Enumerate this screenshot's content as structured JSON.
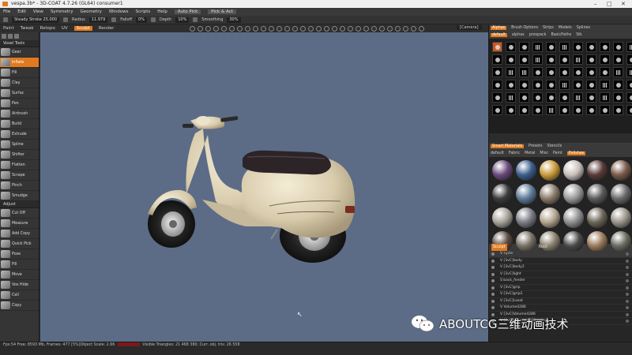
{
  "window": {
    "title": "vespa.3b* - 3D-COAT 4.7.26 (GL64) consumer1"
  },
  "menu": {
    "items": [
      "File",
      "Edit",
      "View",
      "Symmetry",
      "Geometry",
      "Windows",
      "Scripts",
      "Help"
    ],
    "selected": "Auto Pick",
    "pick_act": "Pick & Act"
  },
  "options": {
    "stroke": "Steady Stroke 25.000",
    "radius_label": "Radius",
    "radius": "11.979",
    "falloff_label": "Falloff",
    "falloff": "0%",
    "depth_label": "Depth",
    "depth": "10%",
    "smoothing_label": "Smoothing",
    "smoothing": "30%"
  },
  "rooms": {
    "tabs": [
      "Paint",
      "Tweak",
      "Retopo",
      "UV",
      "Sculpt",
      "Render"
    ],
    "active": "Sculpt"
  },
  "camera": "[Camera]",
  "left_panel": {
    "voxel_section": "Voxel Tools",
    "voxel_tools": [
      "Gear",
      "Inflate",
      "Fill",
      "Clay",
      "Surfac",
      "Pen",
      "Airbrush",
      "Build",
      "Extrude",
      "Spline",
      "Shifter",
      "Flatten",
      "Scrape",
      "Pinch",
      "Smudge"
    ],
    "active_tool": "Inflate",
    "adjust_section": "Adjust",
    "adjust_tools": [
      "Cut Off",
      "Measure",
      "Add Copy",
      "Quick Pick",
      "Pose",
      "Fill",
      "Move",
      "Vox Hide",
      "Cell",
      "Copy"
    ]
  },
  "right_panel": {
    "alpha_tabs": [
      "Alphas",
      "Brush Options",
      "Strips",
      "Models",
      "Splines"
    ],
    "alpha_subtabs": [
      "default",
      "alphas",
      "prospack",
      "BasicPaths",
      "Stk"
    ],
    "material_tabs": [
      "Smart Materials",
      "Presets",
      "Stencils"
    ],
    "material_subtabs": [
      "default",
      "Fabric",
      "Metal",
      "Misc",
      "Paint",
      "Polishes"
    ],
    "material_colors": [
      "#6a4a7a",
      "#3d5f8c",
      "#c99a3a",
      "#c9c0bd",
      "#5a3a3a",
      "#7a5a4a",
      "#3c3c3c",
      "#5f7a99",
      "#8a7a6a",
      "#9a9a9a",
      "#5a5a5a",
      "#6a6a6a",
      "#a8a39a",
      "#7a7d85",
      "#b2a58f",
      "#8f8f8f",
      "#6d6558",
      "#9a958a",
      "#5a4a42",
      "#7a7065",
      "#8a8070",
      "#4a4a4a",
      "#9a7a5a",
      "#6a6a60"
    ],
    "layers_title": "Sculpt",
    "layers_column": "Root",
    "layers": [
      "V  cycle",
      "V  [3vC]body",
      "V  [3vC]body2",
      "V  [3vC]light",
      "S  back_fender",
      "V  [3vC]grip",
      "V  [3vC]grip2",
      "V  [3vC]Lseat",
      "V  Volume4286",
      "V  [3vC]Volume4286",
      "V  [3vC]Volume4286_mirror"
    ]
  },
  "status": {
    "left": "Fps:54",
    "text": "Free: 8593 Mb, Frames: 477 [5%]Object Scale: 2.66",
    "right": "Visible Triangles: 21 468 380; Curr. obj. tris: 26 558"
  },
  "watermark": {
    "text": "ABOUTCG三维动画技术"
  }
}
